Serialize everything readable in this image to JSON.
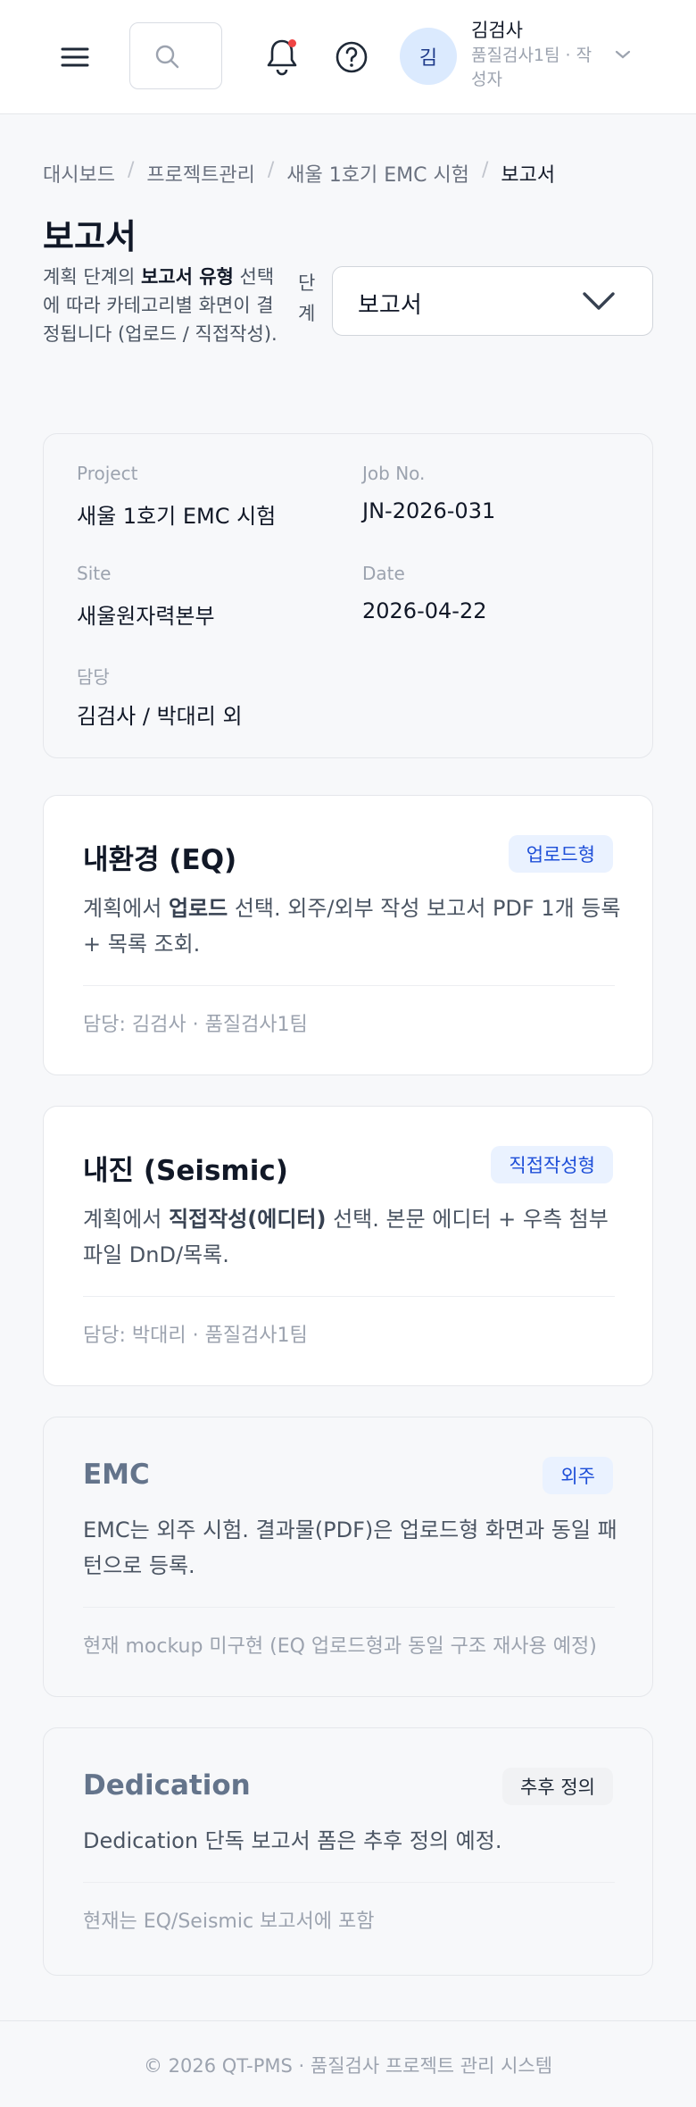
{
  "header": {
    "menu_icon": "hamburger-menu-icon",
    "search_icon": "search-icon",
    "bell_icon": "bell-icon",
    "help_icon": "help-circle-icon",
    "user": {
      "avatar_initial": "김",
      "name": "김검사",
      "team": "품질검사1팀 · 작성자"
    }
  },
  "breadcrumb": [
    "대시보드",
    "프로젝트관리",
    "새울 1호기 EMC 시험",
    "보고서"
  ],
  "page": {
    "title": "보고서",
    "desc_prefix": "계획 단계의 ",
    "desc_bold": "보고서 유형",
    "desc_suffix": " 선택에 따라 카테고리별 화면이 결정됩니다 (업로드 / 직접작성).",
    "stage_label": "단계",
    "stage_value": "보고서"
  },
  "meta": {
    "project_label": "Project",
    "project_value": "새울 1호기 EMC 시험",
    "job_label": "Job No.",
    "job_value": "JN-2026-031",
    "site_label": "Site",
    "site_value": "새울원자력본부",
    "date_label": "Date",
    "date_value": "2026-04-22",
    "owner_label": "담당",
    "owner_value": "김검사 / 박대리 외"
  },
  "cards": [
    {
      "title": "내환경 (EQ)",
      "badge": "업로드형",
      "desc_prefix": "계획에서 ",
      "desc_bold": "업로드",
      "desc_suffix": " 선택. 외주/외부 작성 보고서 PDF 1개 등록 + 목록 조회.",
      "foot": "담당: 김검사 · 품질검사1팀"
    },
    {
      "title": "내진 (Seismic)",
      "badge": "직접작성형",
      "desc_prefix": "계획에서 ",
      "desc_bold": "직접작성(에디터)",
      "desc_suffix": " 선택. 본문 에디터 + 우측 첨부파일 DnD/목록.",
      "foot": "담당: 박대리 · 품질검사1팀"
    },
    {
      "title": "EMC",
      "badge": "외주",
      "desc": "EMC는 외주 시험. 결과물(PDF)은 업로드형 화면과 동일 패턴으로 등록.",
      "foot": "현재 mockup 미구현 (EQ 업로드형과 동일 구조 재사용 예정)"
    },
    {
      "title": "Dedication",
      "badge": "추후 정의",
      "desc": "Dedication 단독 보고서 폼은 추후 정의 예정.",
      "foot": "현재는 EQ/Seismic 보고서에 포함"
    }
  ],
  "footer": "© 2026 QT-PMS · 품질검사 프로젝트 관리 시스템"
}
